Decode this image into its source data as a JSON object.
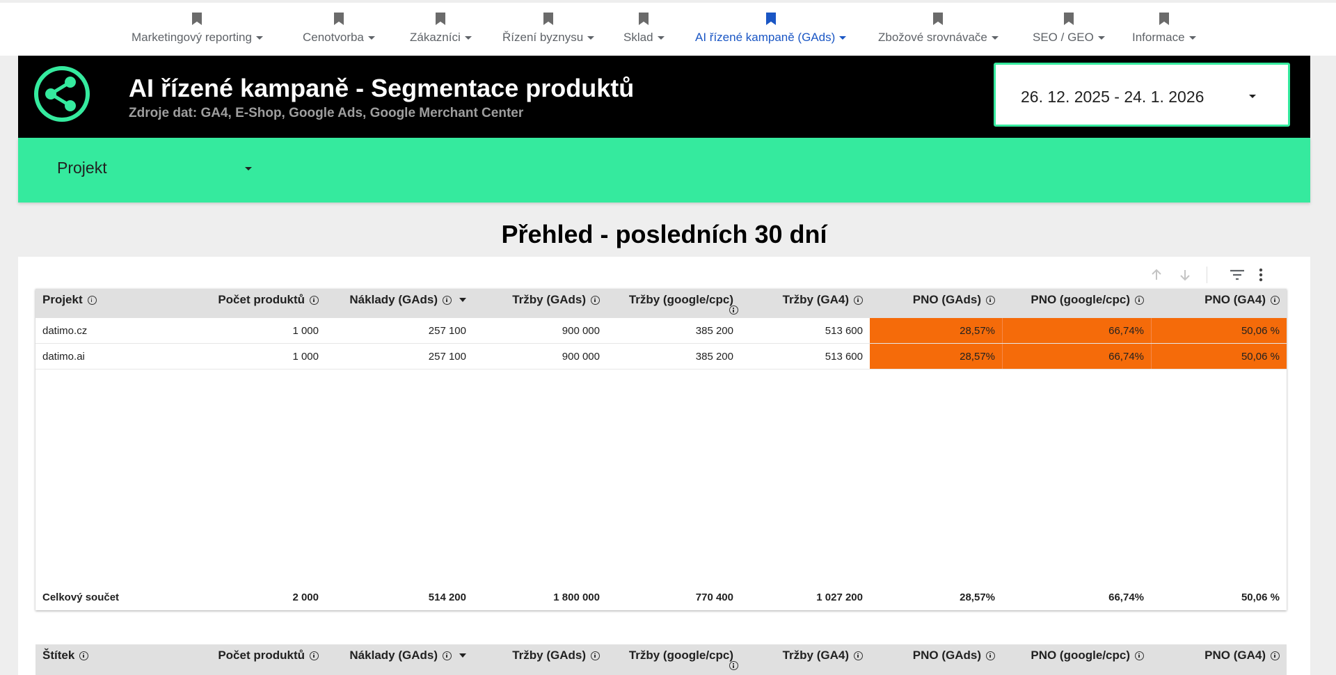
{
  "nav": {
    "items": [
      {
        "label": "Marketingový reporting"
      },
      {
        "label": "Cenotvorba"
      },
      {
        "label": "Zákazníci"
      },
      {
        "label": "Řízení byznysu"
      },
      {
        "label": "Sklad"
      },
      {
        "label": "AI řízené kampaně (GAds)",
        "active": true
      },
      {
        "label": "Zbožové srovnávače"
      },
      {
        "label": "SEO / GEO"
      },
      {
        "label": "Informace"
      }
    ]
  },
  "header": {
    "title": "AI řízené kampaně - Segmentace produktů",
    "subtitle": "Zdroje dat: GA4, E-Shop, Google Ads, Google Merchant Center",
    "logo_icon": "share-icon",
    "date_range": "26. 12. 2025 - 24. 1. 2026"
  },
  "filter": {
    "project_label": "Projekt"
  },
  "section": {
    "title": "Přehled - posledních 30 dní"
  },
  "colors": {
    "accent": "#35ea9e",
    "highlight": "#f56b0a",
    "nav_active": "#1a56c4"
  },
  "table1": {
    "columns": [
      "Projekt",
      "Počet produktů",
      "Náklady (GAds)",
      "Tržby (GAds)",
      "Tržby (google/cpc)",
      "Tržby (GA4)",
      "PNO (GAds)",
      "PNO (google/cpc)",
      "PNO (GA4)"
    ],
    "rows": [
      [
        "datimo.cz",
        "1 000",
        "257 100",
        "900 000",
        "385 200",
        "513 600",
        "28,57%",
        "66,74%",
        "50,06 %"
      ],
      [
        "datimo.ai",
        "1 000",
        "257 100",
        "900 000",
        "385 200",
        "513 600",
        "28,57%",
        "66,74%",
        "50,06 %"
      ]
    ],
    "totals": [
      "Celkový součet",
      "2 000",
      "514 200",
      "1 800 000",
      "770 400",
      "1 027 200",
      "28,57%",
      "66,74%",
      "50,06 %"
    ]
  },
  "table2": {
    "columns": [
      "Štítek",
      "Počet produktů",
      "Náklady (GAds)",
      "Tržby (GAds)",
      "Tržby (google/cpc)",
      "Tržby (GA4)",
      "PNO (GAds)",
      "PNO (google/cpc)",
      "PNO (GA4)"
    ]
  }
}
